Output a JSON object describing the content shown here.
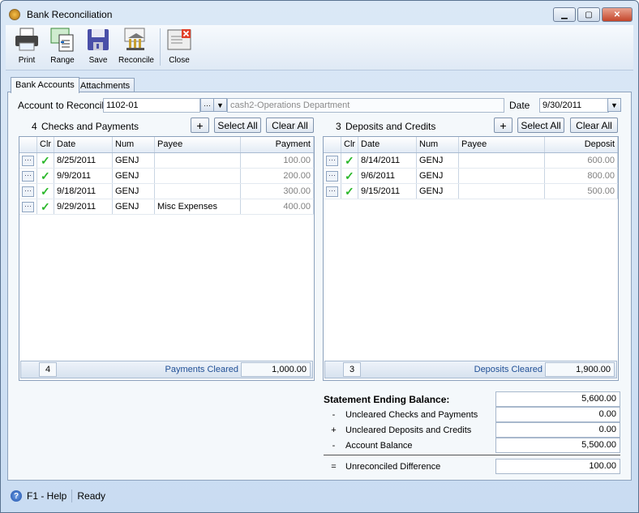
{
  "window": {
    "title": "Bank Reconciliation"
  },
  "toolbar": [
    {
      "label": "Print",
      "icon": "printer-icon"
    },
    {
      "label": "Range",
      "icon": "range-icon"
    },
    {
      "label": "Save",
      "icon": "save-icon"
    },
    {
      "label": "Reconcile",
      "icon": "bank-icon"
    },
    {
      "label": "Close",
      "icon": "close-icon"
    }
  ],
  "tabs": [
    {
      "label": "Bank Accounts",
      "active": true
    },
    {
      "label": "Attachments",
      "active": false
    }
  ],
  "account": {
    "label": "Account to Reconcile",
    "value": "1102-01",
    "description": "cash2-Operations Department",
    "date_label": "Date",
    "date_value": "9/30/2011"
  },
  "checks": {
    "count": "4",
    "title": "Checks and Payments",
    "add": "+",
    "select_all": "Select All",
    "clear_all": "Clear All",
    "columns": [
      "",
      "Clr",
      "Date",
      "Num",
      "Payee",
      "Payment"
    ],
    "rows": [
      {
        "date": "8/25/2011",
        "num": "GENJ",
        "payee": "",
        "amount": "100.00"
      },
      {
        "date": "9/9/2011",
        "num": "GENJ",
        "payee": "",
        "amount": "200.00"
      },
      {
        "date": "9/18/2011",
        "num": "GENJ",
        "payee": "",
        "amount": "300.00"
      },
      {
        "date": "9/29/2011",
        "num": "GENJ",
        "payee": "Misc Expenses",
        "amount": "400.00"
      }
    ],
    "footer_count": "4",
    "footer_label": "Payments Cleared",
    "footer_total": "1,000.00"
  },
  "deposits": {
    "count": "3",
    "title": "Deposits and Credits",
    "add": "+",
    "select_all": "Select All",
    "clear_all": "Clear All",
    "columns": [
      "",
      "Clr",
      "Date",
      "Num",
      "Payee",
      "Deposit"
    ],
    "rows": [
      {
        "date": "8/14/2011",
        "num": "GENJ",
        "payee": "",
        "amount": "600.00"
      },
      {
        "date": "9/6/2011",
        "num": "GENJ",
        "payee": "",
        "amount": "800.00"
      },
      {
        "date": "9/15/2011",
        "num": "GENJ",
        "payee": "",
        "amount": "500.00"
      }
    ],
    "footer_count": "3",
    "footer_label": "Deposits Cleared",
    "footer_total": "1,900.00"
  },
  "summary": {
    "statement_label": "Statement Ending Balance:",
    "statement_value": "5,600.00",
    "lines": [
      {
        "sign": "-",
        "label": "Uncleared Checks and Payments",
        "value": "0.00"
      },
      {
        "sign": "+",
        "label": "Uncleared Deposits and Credits",
        "value": "0.00"
      },
      {
        "sign": "-",
        "label": "Account Balance",
        "value": "5,500.00"
      }
    ],
    "diff_sign": "=",
    "diff_label": "Unreconciled Difference",
    "diff_value": "100.00"
  },
  "status": {
    "help": "F1 - Help",
    "state": "Ready"
  },
  "colors": {
    "check": "#2bb82b",
    "accent": "#1f4f96"
  }
}
